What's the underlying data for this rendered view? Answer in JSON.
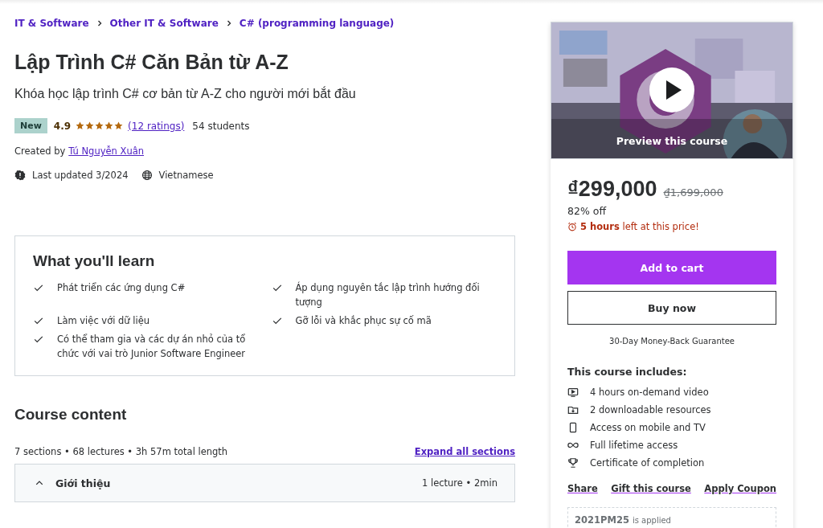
{
  "breadcrumbs": [
    {
      "label": "IT & Software"
    },
    {
      "label": "Other IT & Software"
    },
    {
      "label": "C# (programming language)"
    }
  ],
  "title": "Lập Trình C# Căn Bản từ A-Z",
  "subtitle": "Khóa học lập trình C# cơ bản từ A-Z cho người mới bắt đầu",
  "rating": {
    "badge": "New",
    "score": "4.9",
    "stars": 5,
    "ratings_link": "(12 ratings)",
    "students": "54 students"
  },
  "created_by": {
    "label": "Created by",
    "author": "Tú Nguyễn Xuân"
  },
  "meta": [
    {
      "kind": "updated",
      "text": "Last updated 3/2024"
    },
    {
      "kind": "language",
      "text": "Vietnamese"
    }
  ],
  "learn": {
    "title": "What you'll learn",
    "items": [
      {
        "text": "Phát triển các ứng dụng C#"
      },
      {
        "text": "Áp dụng nguyên tắc lập trình hướng đối tượng"
      },
      {
        "text": "Làm việc với dữ liệu"
      },
      {
        "text": "Gỡ lỗi và khắc phục sự cố mã"
      },
      {
        "text": "Có thể tham gia và các dự án nhỏ của tổ chức với vai trò Junior Software Engineer"
      }
    ]
  },
  "course_content": {
    "title": "Course content",
    "summary": "7 sections • 68 lectures • 3h 57m total length",
    "expand_link": "Expand all sections",
    "sections": [
      {
        "title": "Giới thiệu",
        "info": "1 lecture • 2min",
        "expanded": true
      }
    ]
  },
  "sidebar": {
    "preview": {
      "kind": "picture",
      "label": "Preview this course"
    },
    "price": "₫299,000",
    "original_price": "₫1,699,000",
    "discount": "82% off",
    "timer": {
      "bold": "5 hours",
      "rest": "left at this price!"
    },
    "buttons": [
      {
        "kind": "primary",
        "label": "Add to cart"
      },
      {
        "kind": "secondary",
        "label": "Buy now"
      }
    ],
    "guarantee": "30-Day Money-Back Guarantee",
    "includes_title": "This course includes:",
    "includes": [
      {
        "kind": "video",
        "text": "4 hours on-demand video"
      },
      {
        "kind": "download",
        "text": "2 downloadable resources"
      },
      {
        "kind": "mobile",
        "text": "Access on mobile and TV"
      },
      {
        "kind": "infinity",
        "text": "Full lifetime access"
      },
      {
        "kind": "trophy",
        "text": "Certificate of completion"
      }
    ],
    "links": [
      {
        "label": "Share"
      },
      {
        "label": "Gift this course"
      },
      {
        "label": "Apply Coupon"
      }
    ],
    "coupon": {
      "code": "2021PM25",
      "note": "is applied"
    }
  }
}
